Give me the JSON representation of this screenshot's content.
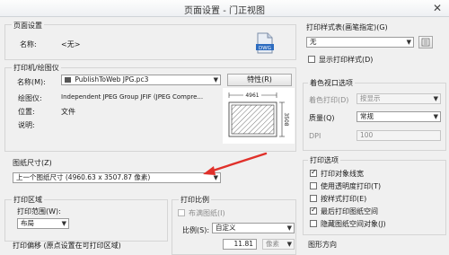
{
  "window": {
    "title": "页面设置 - 门正视图",
    "close_icon": "close-icon"
  },
  "page_setup": {
    "group_label": "页面设置",
    "name_label": "名称:",
    "name_value": "<无>",
    "dwg_icon_text": "DWG"
  },
  "printer": {
    "group_label": "打印机/绘图仪",
    "name_label": "名称(M):",
    "name_value": "PublishToWeb JPG.pc3",
    "properties_button": "特性(R)",
    "plotter_label": "绘图仪:",
    "plotter_value": "Independent JPEG Group JFIF (JPEG Compre...",
    "location_label": "位置:",
    "location_value": "文件",
    "description_label": "说明:",
    "preview_width": "4961",
    "preview_height": "3508"
  },
  "paper_size": {
    "label": "图纸尺寸(Z)",
    "value": "上一个图纸尺寸  (4960.63 x 3507.87 像素)"
  },
  "plot_area": {
    "group_label": "打印区域",
    "range_label": "打印范围(W):",
    "range_value": "布局"
  },
  "plot_offset": {
    "label": "打印偏移 (原点设置在可打印区域)"
  },
  "plot_scale": {
    "group_label": "打印比例",
    "fit_paper_label": "布满图纸(I)",
    "scale_label": "比例(S):",
    "scale_value": "自定义",
    "value": "11.81",
    "unit": "像素"
  },
  "plot_style_table": {
    "group_label": "打印样式表(画笔指定)(G)",
    "value": "无",
    "show_styles_label": "显示打印样式(D)"
  },
  "shaded_viewport": {
    "group_label": "着色视口选项",
    "shade_plot_label": "着色打印(D)",
    "shade_plot_value": "按显示",
    "quality_label": "质量(Q)",
    "quality_value": "常规",
    "dpi_label": "DPI",
    "dpi_value": "100"
  },
  "plot_options": {
    "group_label": "打印选项",
    "items": [
      {
        "label": "打印对象线宽",
        "checked": true
      },
      {
        "label": "使用透明度打印(T)",
        "checked": false
      },
      {
        "label": "按样式打印(E)",
        "checked": false
      },
      {
        "label": "最后打印图纸空间",
        "checked": true
      },
      {
        "label": "隐藏图纸空间对象(J)",
        "checked": false
      }
    ]
  },
  "drawing_orientation": {
    "group_label": "图形方向"
  },
  "accent_color": "#e0302a"
}
